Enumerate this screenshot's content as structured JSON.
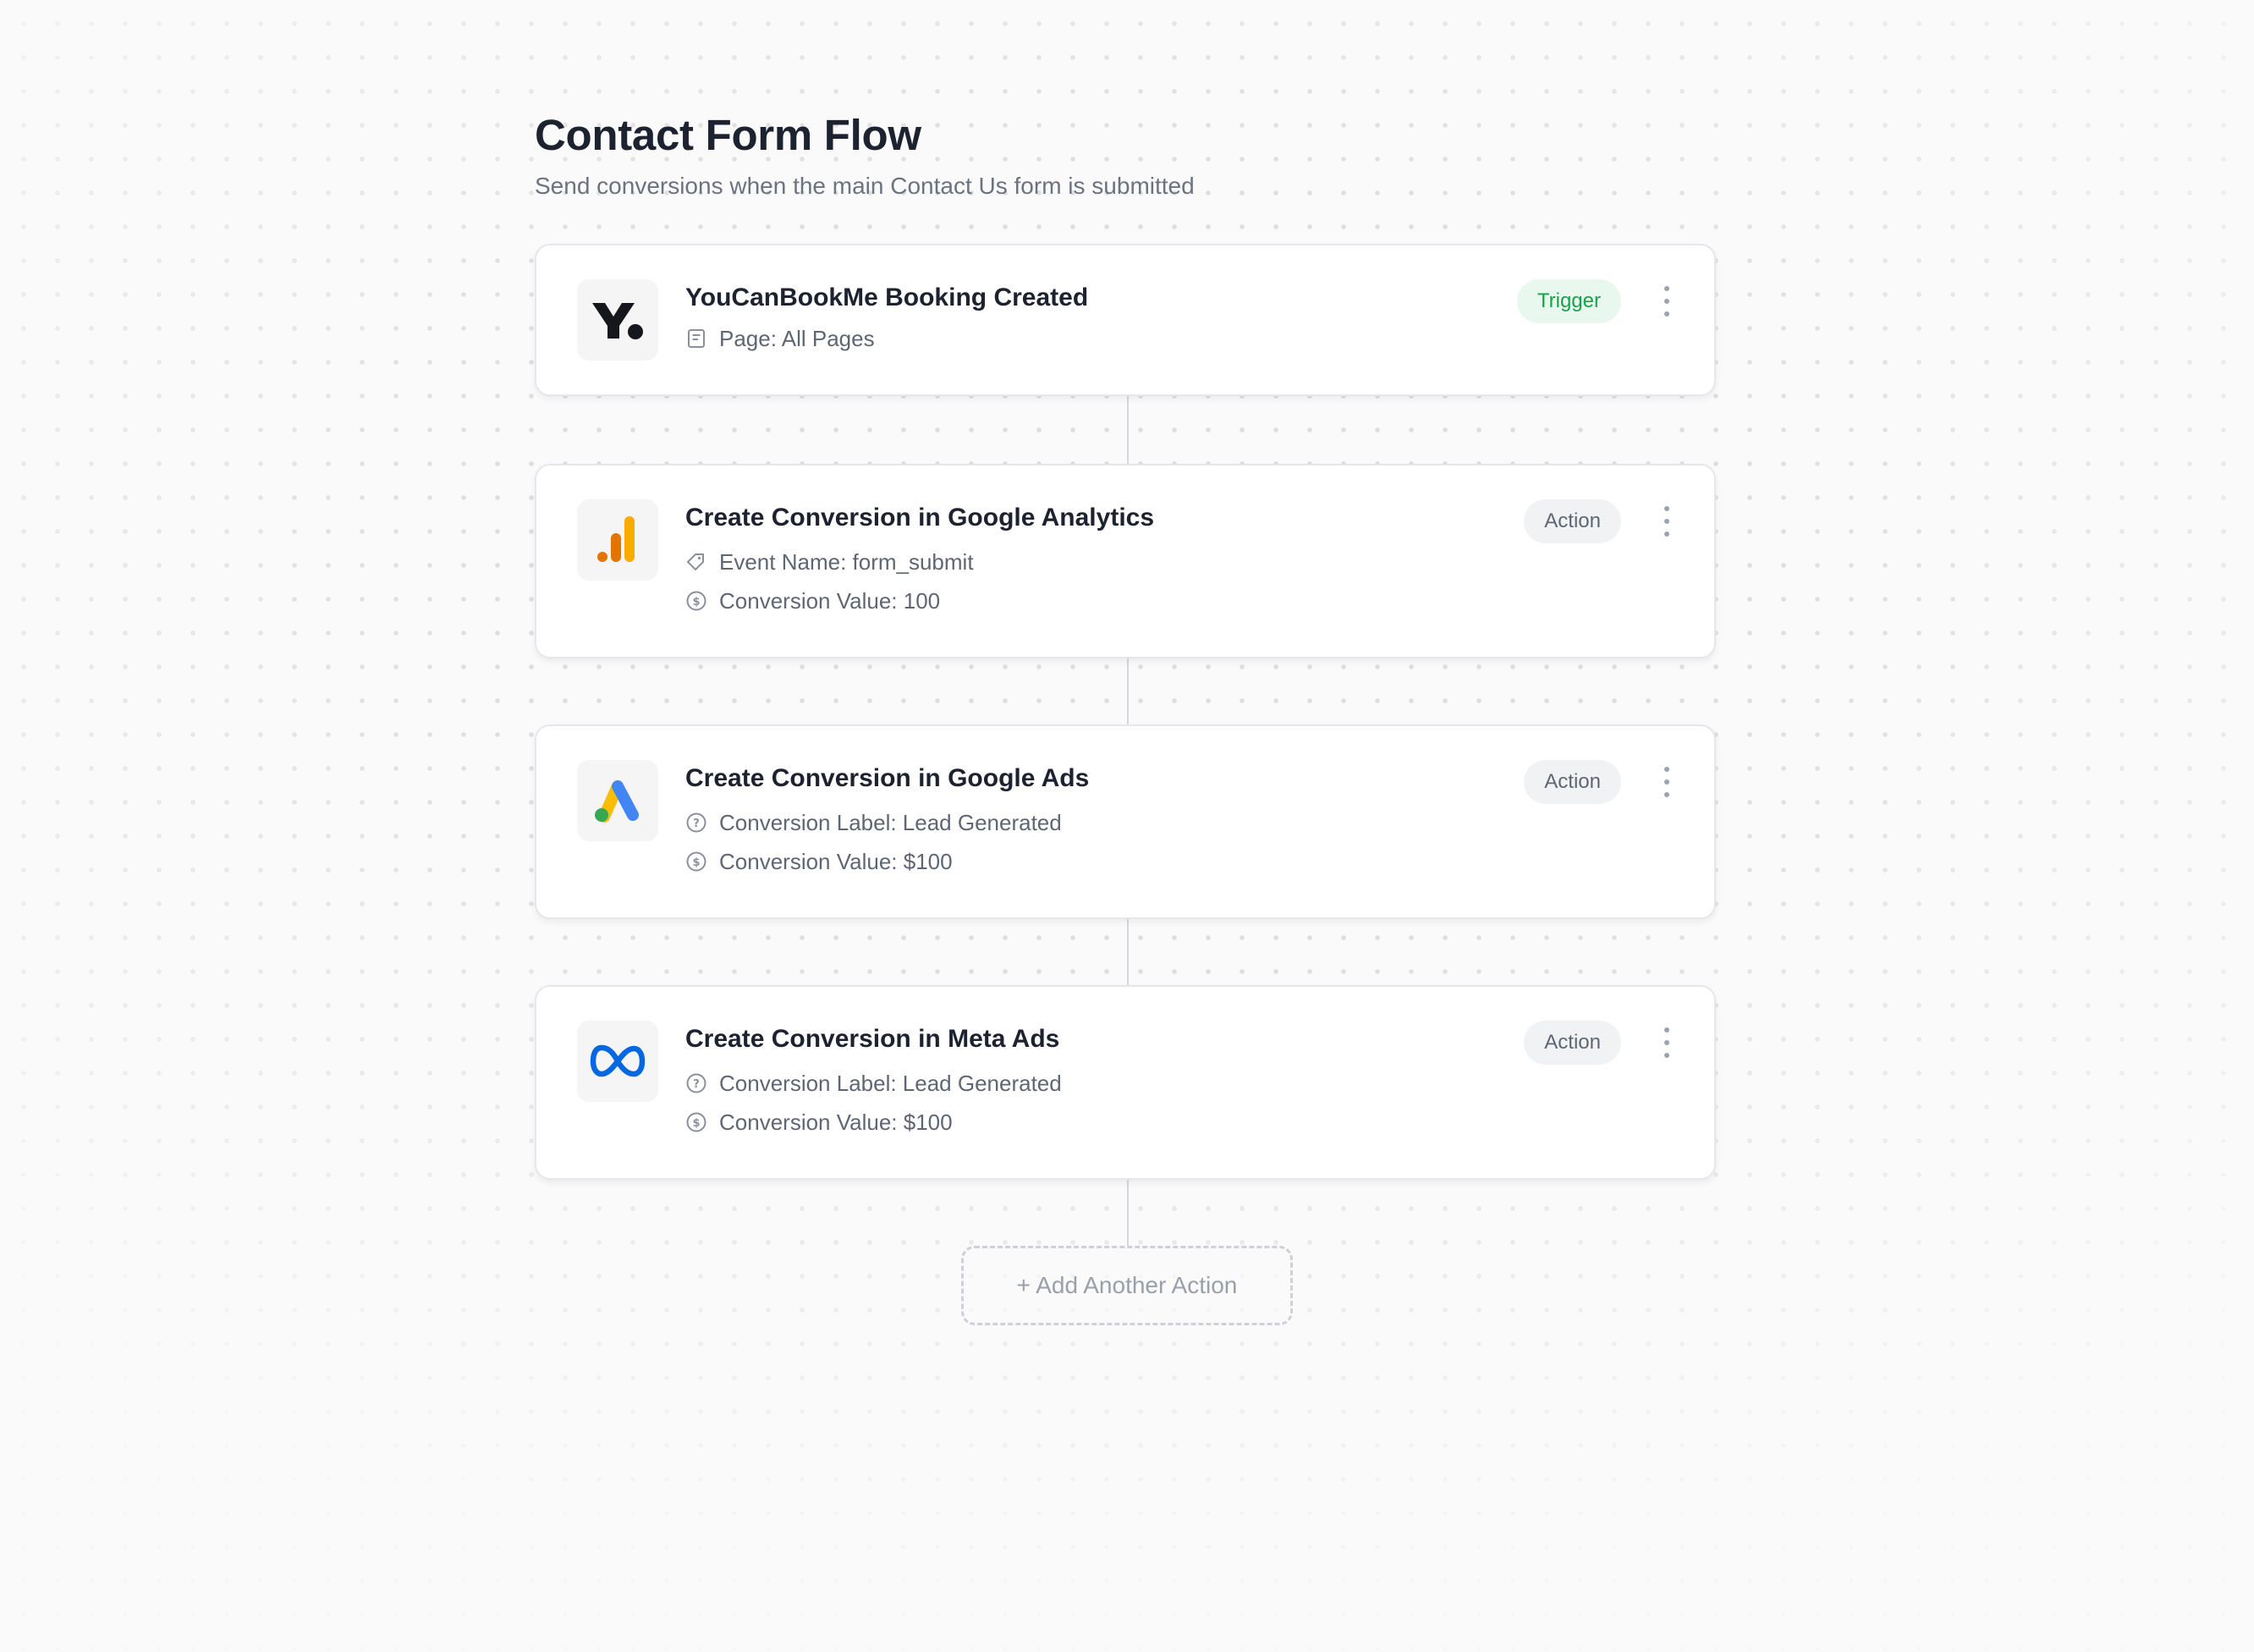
{
  "flow": {
    "title": "Contact Form Flow",
    "subtitle": "Send conversions when the main Contact Us form is submitted"
  },
  "steps": [
    {
      "title": "YouCanBookMe Booking Created",
      "badge": "Trigger",
      "logo": "youcanbookme-logo",
      "details": [
        {
          "icon": "page-icon",
          "text": "Page: All Pages"
        }
      ]
    },
    {
      "title": "Create Conversion in Google Analytics",
      "badge": "Action",
      "logo": "google-analytics-logo",
      "details": [
        {
          "icon": "tag-icon",
          "text": "Event Name: form_submit"
        },
        {
          "icon": "dollar-icon",
          "text": "Conversion Value: 100"
        }
      ]
    },
    {
      "title": "Create Conversion in Google Ads",
      "badge": "Action",
      "logo": "google-ads-logo",
      "details": [
        {
          "icon": "help-circle-icon",
          "text": "Conversion Label: Lead Generated"
        },
        {
          "icon": "dollar-icon",
          "text": "Conversion Value: $100"
        }
      ]
    },
    {
      "title": "Create Conversion in Meta Ads",
      "badge": "Action",
      "logo": "meta-logo",
      "details": [
        {
          "icon": "help-circle-icon",
          "text": "Conversion Label: Lead Generated"
        },
        {
          "icon": "dollar-icon",
          "text": "Conversion Value: $100"
        }
      ]
    }
  ],
  "add_action_label": "+ Add Another Action",
  "colors": {
    "trigger_badge_bg": "#e9f8ee",
    "trigger_badge_text": "#16a34a",
    "action_badge_bg": "#f1f2f4",
    "action_badge_text": "#5f6673",
    "ga_orange": "#e37400",
    "ga_yellow": "#f9ab00",
    "ads_blue": "#4285f4",
    "ads_yellow": "#fbbc04",
    "ads_green": "#34a853",
    "meta_blue": "#0668e1"
  }
}
